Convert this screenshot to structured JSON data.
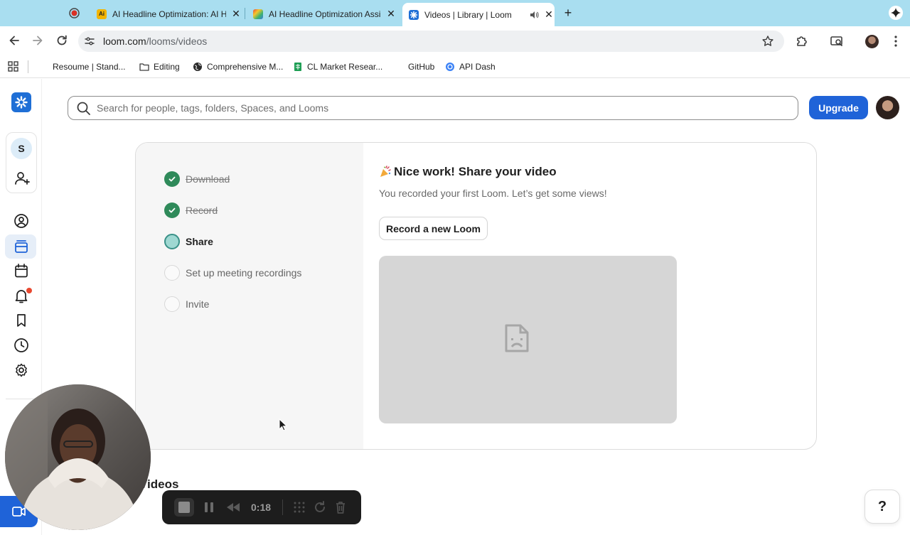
{
  "browser": {
    "tabs": [
      {
        "title": "AI Headline Optimization: AI H",
        "favicon": "ai-tool-favicon",
        "active": false
      },
      {
        "title": "AI Headline Optimization Assi",
        "favicon": "rainbow-favicon",
        "active": false
      },
      {
        "title": "Videos | Library | Loom",
        "favicon": "loom-favicon",
        "active": true
      }
    ],
    "url_host": "loom.com",
    "url_path": "/looms/videos",
    "bookmarks": [
      {
        "label": "Resoume | Stand..."
      },
      {
        "label": "Editing"
      },
      {
        "label": "Comprehensive M..."
      },
      {
        "label": "CL Market Resear..."
      },
      {
        "label": "GitHub"
      },
      {
        "label": "API Dash"
      }
    ]
  },
  "sidebar": {
    "workspace_initial": "S"
  },
  "search": {
    "placeholder": "Search for people, tags, folders, Spaces, and Looms"
  },
  "header": {
    "upgrade_label": "Upgrade"
  },
  "onboarding": {
    "steps": [
      {
        "label": "Download",
        "state": "done"
      },
      {
        "label": "Record",
        "state": "done"
      },
      {
        "label": "Share",
        "state": "current"
      },
      {
        "label": "Set up meeting recordings",
        "state": "todo"
      },
      {
        "label": "Invite",
        "state": "todo"
      }
    ],
    "title": "Nice work! Share your video",
    "subtitle": "You recorded your first Loom. Let’s get some views!",
    "record_button": "Record a new Loom"
  },
  "section": {
    "videos_heading": "Videos"
  },
  "help": {
    "label": "?"
  },
  "recorder": {
    "timer": "0:18"
  },
  "colors": {
    "accent": "#1f63d8",
    "tabstrip": "#a9def0",
    "step_done": "#2f8a5a",
    "step_current": "#9fd8d2",
    "notification": "#e8482f"
  }
}
